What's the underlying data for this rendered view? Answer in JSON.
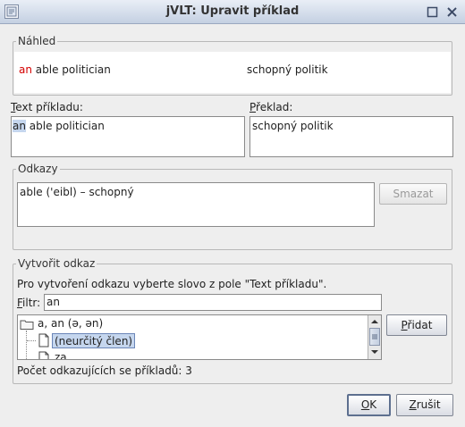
{
  "window": {
    "title": "jVLT: Upravit příklad"
  },
  "preview": {
    "legend": "Náhled",
    "example_word": "an",
    "example_rest": " able politician",
    "translation": "schopný politik"
  },
  "text": {
    "label_first": "T",
    "label_rest": "ext příkladu:",
    "selected_part": "an",
    "rest": " able politician"
  },
  "translation": {
    "label_first": "P",
    "label_rest": "řeklad:",
    "value": "schopný politik"
  },
  "links": {
    "legend": "Odkazy",
    "items": [
      "able ('eibl) – schopný"
    ],
    "delete_label": "Smazat"
  },
  "create_link": {
    "legend": "Vytvořit odkaz",
    "instructions": "Pro vytvoření odkazu vyberte slovo z pole \"Text příkladu\".",
    "filter_label_first": "F",
    "filter_label_rest": "iltr:",
    "filter_value": "an",
    "tree": {
      "root": "a, an (ə, ən)",
      "child": "(neurčitý člen)",
      "partial": "za"
    },
    "add_label_first": "P",
    "add_label_rest": "řidat",
    "count_text": "Počet odkazujících se příkladů: 3"
  },
  "footer": {
    "ok_first": "O",
    "ok_rest": "K",
    "cancel_first": "Z",
    "cancel_rest": "rušit"
  }
}
